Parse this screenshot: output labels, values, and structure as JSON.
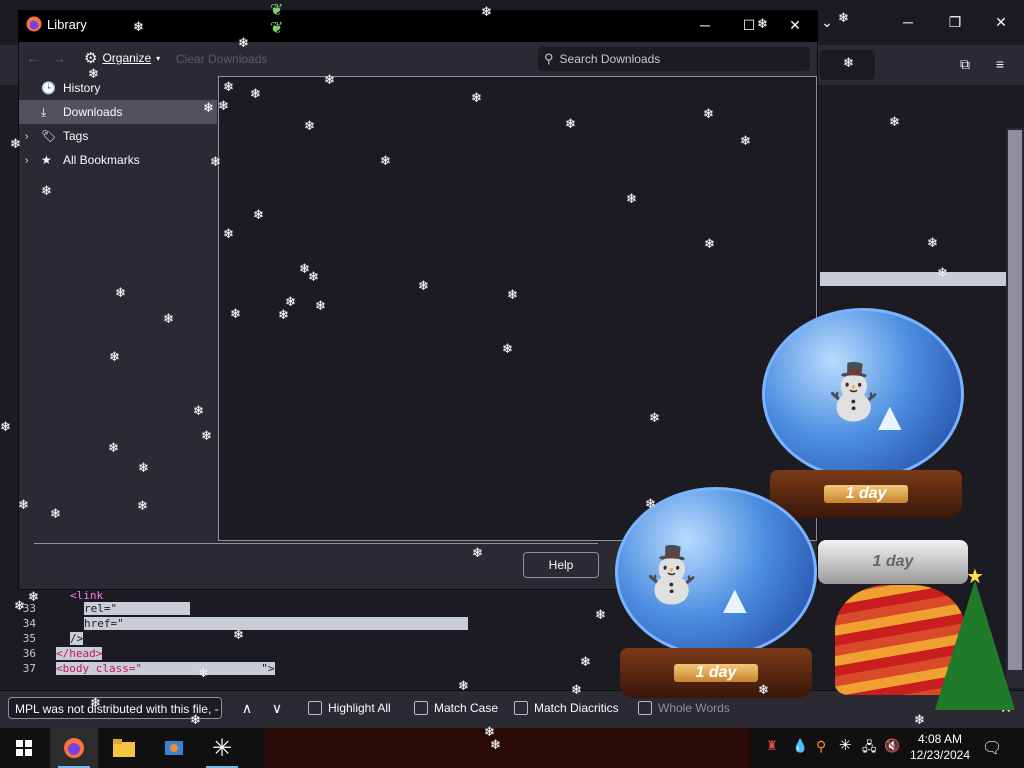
{
  "library": {
    "title": "Library",
    "organize_label": "Organize",
    "clear_downloads_label": "Clear Downloads",
    "search_placeholder": "Search Downloads",
    "sidebar": [
      {
        "label": "History",
        "icon": "clock-icon"
      },
      {
        "label": "Downloads",
        "icon": "download-icon",
        "selected": true
      },
      {
        "label": "Tags",
        "icon": "tag-icon"
      },
      {
        "label": "All Bookmarks",
        "icon": "star-icon"
      }
    ],
    "help_label": "Help"
  },
  "code": {
    "lines": [
      {
        "num": "",
        "text": "<link",
        "type": "tag"
      },
      {
        "num": "33",
        "text": "rel=\"",
        "type": "attr"
      },
      {
        "num": "34",
        "text": "href=\"",
        "type": "attr"
      },
      {
        "num": "35",
        "text": "/>",
        "type": "tag"
      },
      {
        "num": "36",
        "text": "</head>",
        "type": "tag"
      },
      {
        "num": "37",
        "text": "<body class=\"",
        "type": "tag"
      }
    ]
  },
  "findbar": {
    "search_value": "MPL was not distributed with this file, -",
    "highlight_all": "Highlight All",
    "match_case": "Match Case",
    "match_diacritics": "Match Diacritics",
    "whole_words": "Whole Words"
  },
  "globes": {
    "label": "1 day"
  },
  "taskbar": {
    "time": "4:08 AM",
    "date": "12/23/2024"
  },
  "colors": {
    "accent": "#76b9ed",
    "window_bg": "#1c1b22",
    "toolbar_bg": "#2b2a33"
  }
}
